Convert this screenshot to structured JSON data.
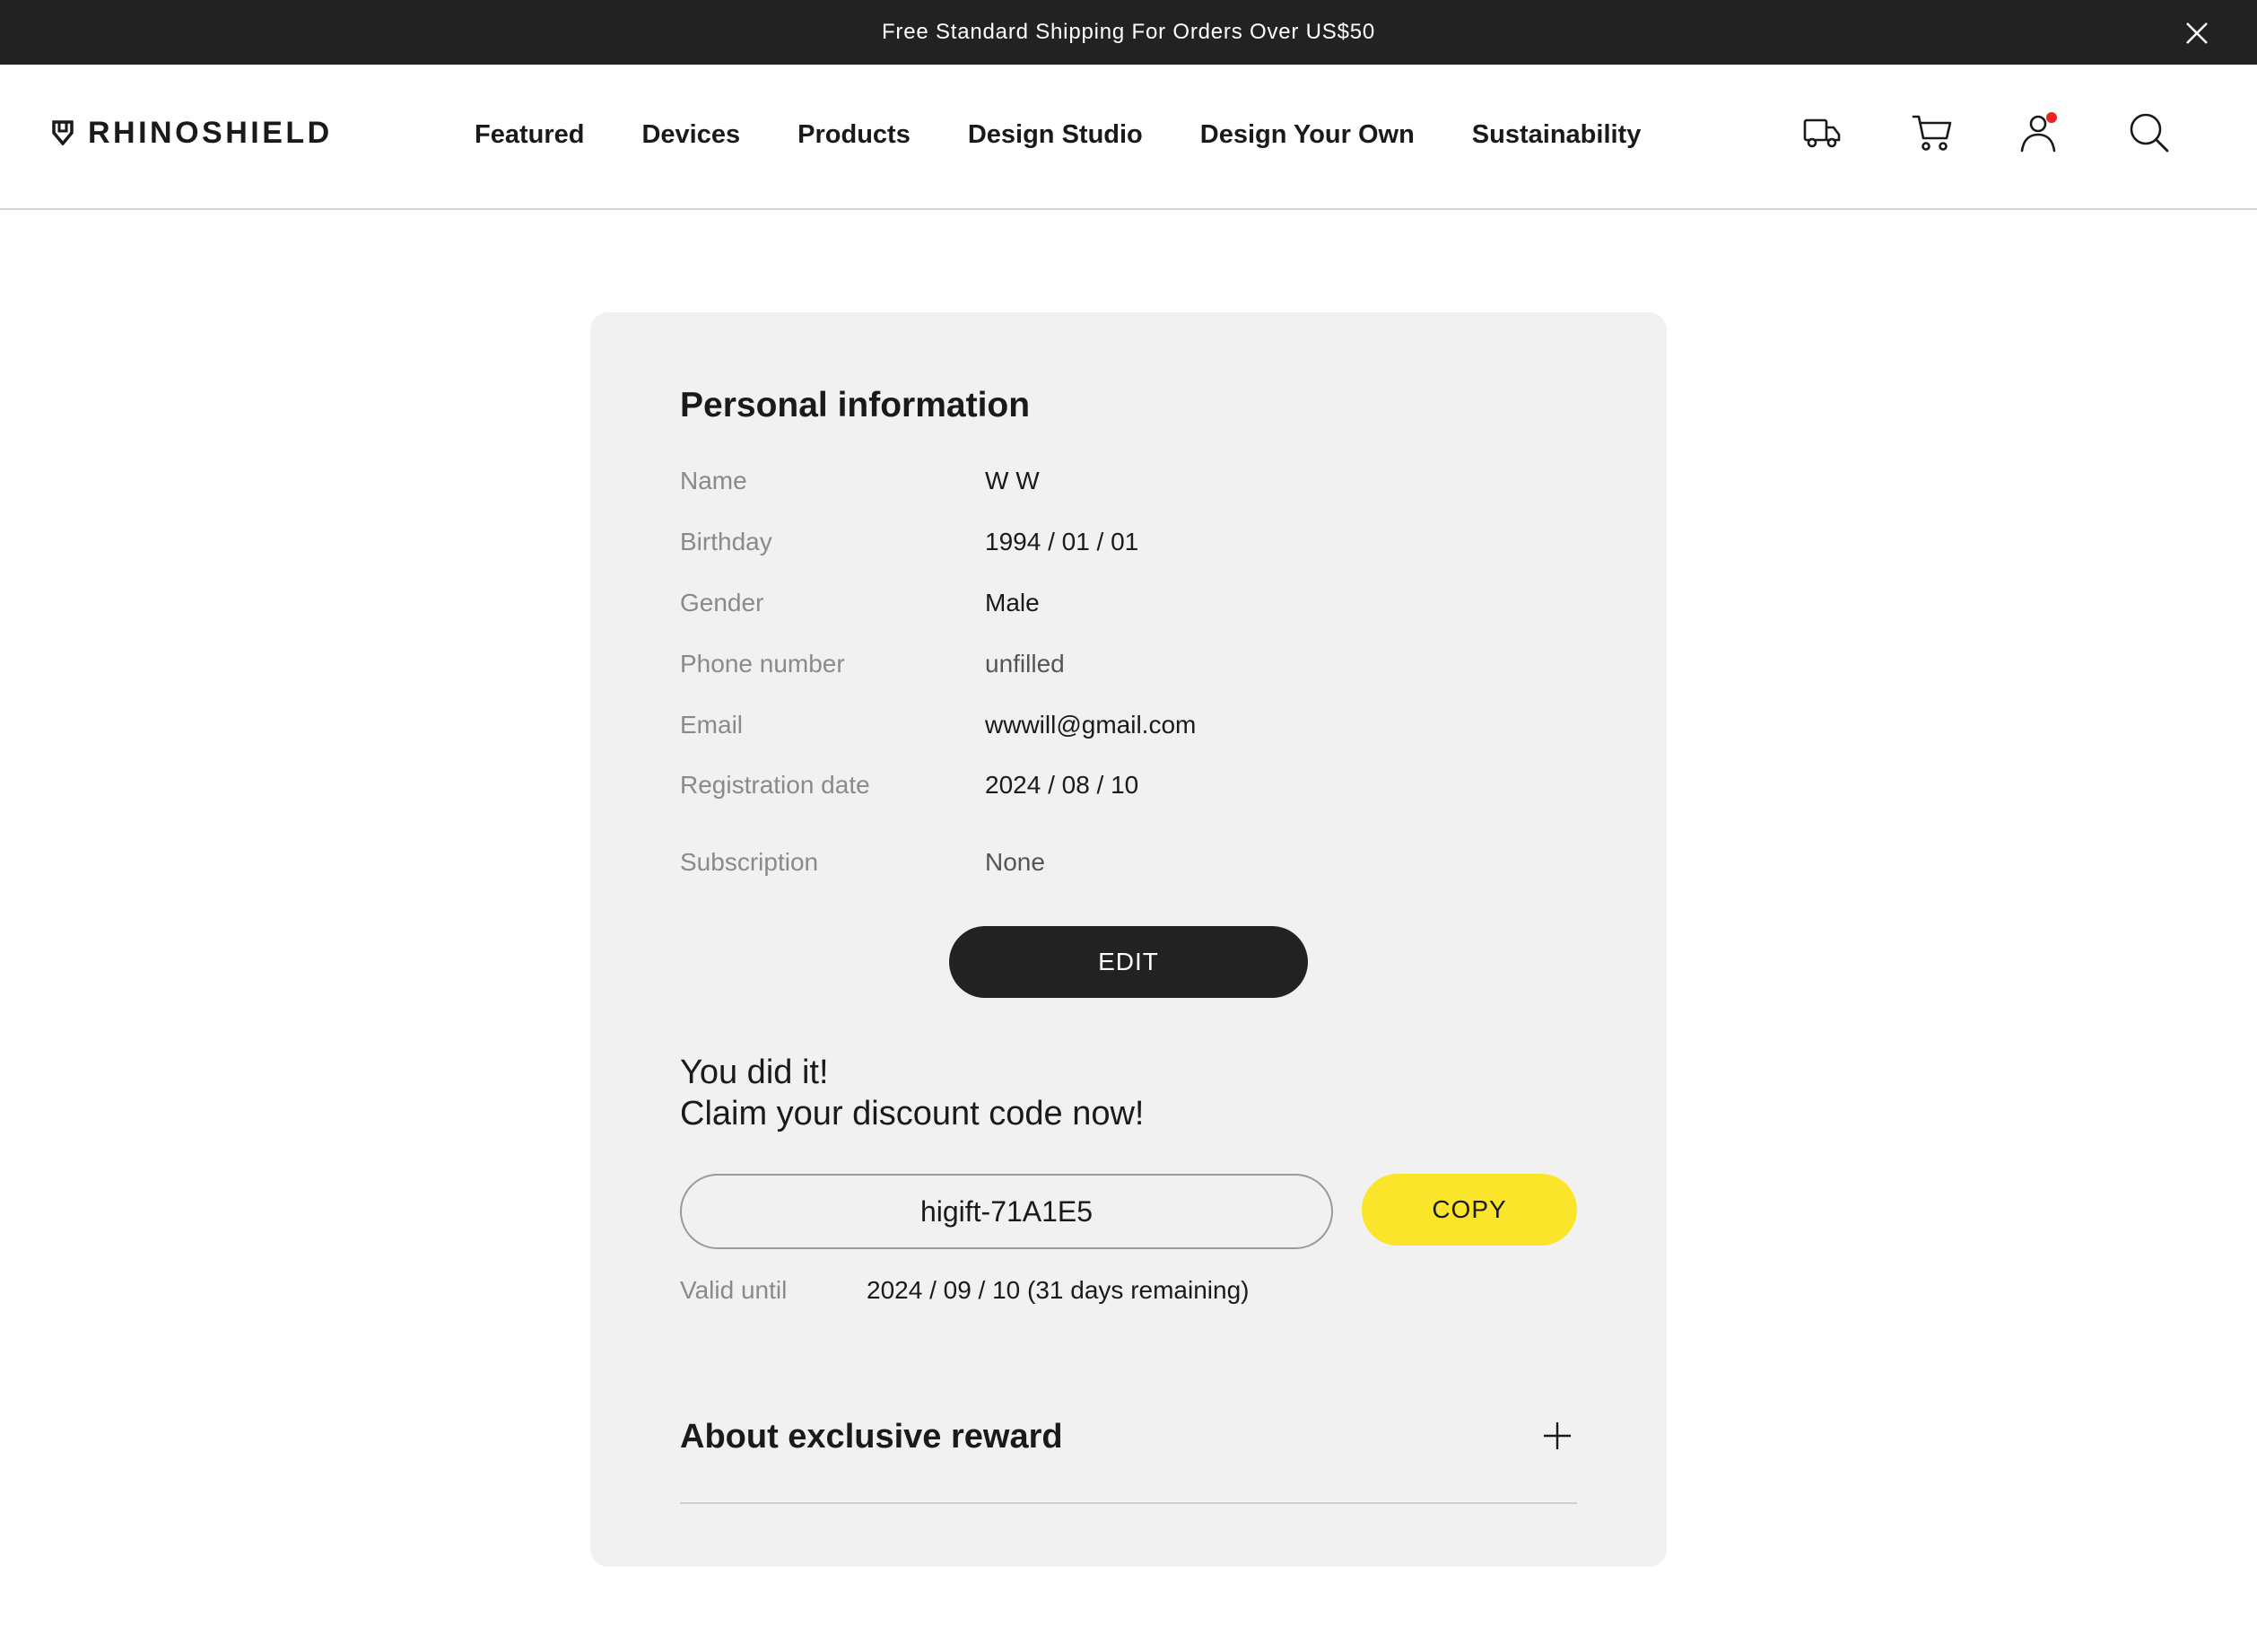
{
  "promo": {
    "text": "Free Standard Shipping For Orders Over US$50",
    "close_icon": "close-icon"
  },
  "header": {
    "logo_text": "RHINOSHIELD",
    "nav": [
      {
        "label": "Featured"
      },
      {
        "label": "Devices"
      },
      {
        "label": "Products"
      },
      {
        "label": "Design Studio"
      },
      {
        "label": "Design Your Own"
      },
      {
        "label": "Sustainability"
      }
    ],
    "icons": [
      "truck-icon",
      "cart-icon",
      "user-icon",
      "search-icon"
    ],
    "notification_color": "#e8251f"
  },
  "personal_info": {
    "title": "Personal information",
    "rows": [
      {
        "label": "Name",
        "value": "W W"
      },
      {
        "label": "Birthday",
        "value": "1994 / 01 / 01"
      },
      {
        "label": "Gender",
        "value": "Male"
      },
      {
        "label": "Phone number",
        "value": "unfilled"
      },
      {
        "label": "Email",
        "value": "wwwill@gmail.com"
      },
      {
        "label": "Registration date",
        "value": "2024 / 08 / 10"
      },
      {
        "label": "Subscription",
        "value": "None"
      }
    ],
    "edit_label": "EDIT"
  },
  "discount": {
    "line1": "You did it!",
    "line2": "Claim your discount code now!",
    "code": "higift-71A1E5",
    "copy_label": "COPY",
    "valid_label": "Valid until",
    "valid_value": "2024 / 09 / 10 (31 days remaining)",
    "accent_color": "#fbe52a"
  },
  "reward": {
    "title": "About exclusive reward"
  }
}
